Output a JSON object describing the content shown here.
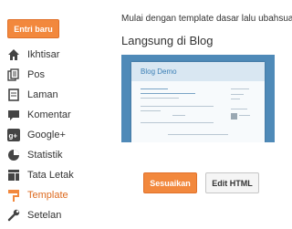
{
  "sidebar": {
    "new_post_label": "Entri baru",
    "items": [
      {
        "label": "Ikhtisar",
        "icon": "home-icon"
      },
      {
        "label": "Pos",
        "icon": "posts-icon"
      },
      {
        "label": "Laman",
        "icon": "pages-icon"
      },
      {
        "label": "Komentar",
        "icon": "comment-icon"
      },
      {
        "label": "Google+",
        "icon": "google-plus-icon"
      },
      {
        "label": "Statistik",
        "icon": "stats-icon"
      },
      {
        "label": "Tata Letak",
        "icon": "layout-icon"
      },
      {
        "label": "Template",
        "icon": "template-icon",
        "active": true
      },
      {
        "label": "Setelan",
        "icon": "settings-icon"
      }
    ]
  },
  "main": {
    "intro_text": "Mulai dengan template dasar lalu ubahsuaikan",
    "section_title": "Langsung di Blog",
    "preview": {
      "blog_title": "Blog Demo"
    },
    "customize_label": "Sesuaikan",
    "edit_html_label": "Edit HTML"
  },
  "colors": {
    "accent": "#f2883d",
    "active_text": "#dd6a1f",
    "preview_background": "#4f8ab8"
  }
}
